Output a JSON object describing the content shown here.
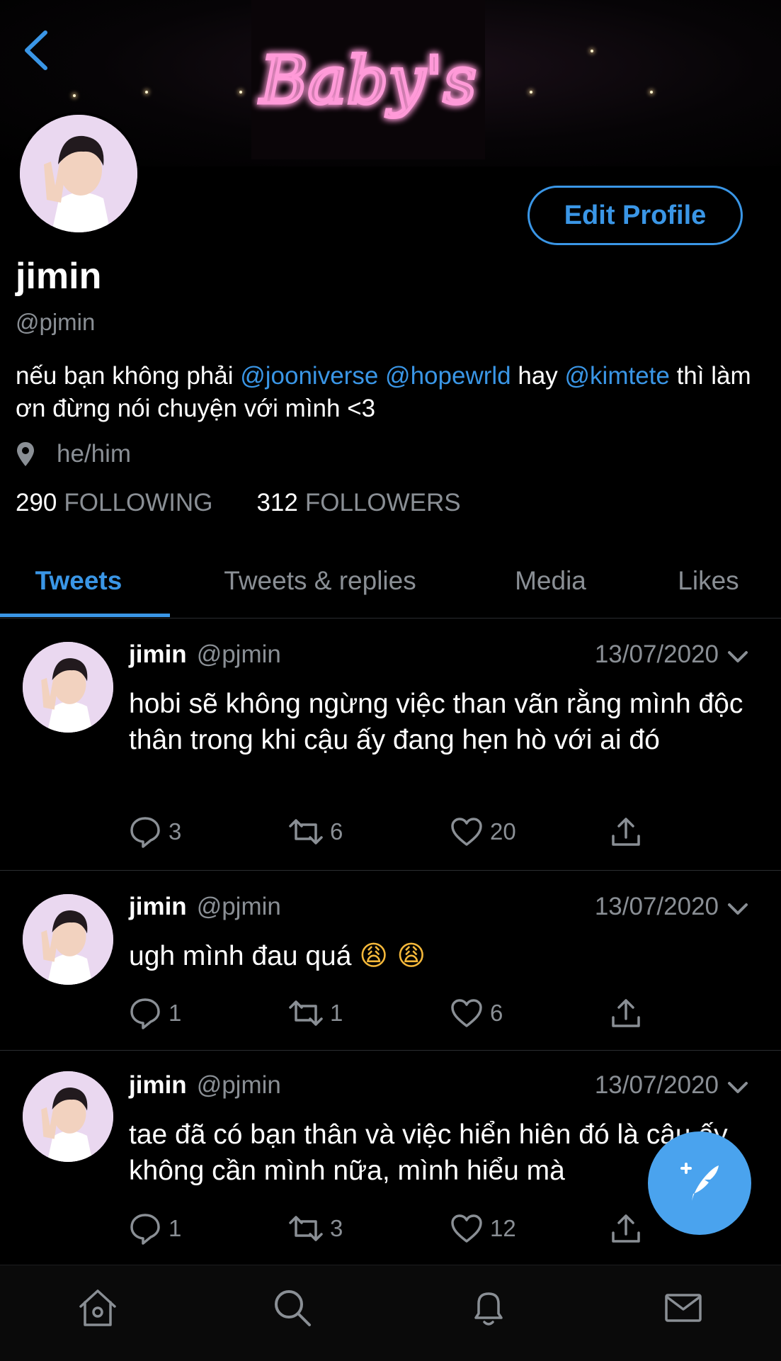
{
  "header": {
    "banner_sign_text": "Baby's",
    "back_icon": "chevron-left-icon"
  },
  "profile": {
    "edit_button_label": "Edit Profile",
    "display_name": "jimin",
    "handle": "@pjmin",
    "bio": {
      "part1": "nếu bạn không phải ",
      "mention1": "@jooniverse",
      "part2": " ",
      "mention2": "@hopewrld",
      "part3": " hay ",
      "mention3": "@kimtete",
      "part4": " thì làm ơn đừng nói chuyện với mình <3"
    },
    "location": "he/him",
    "following_count": "290",
    "following_label": "FOLLOWING",
    "followers_count": "312",
    "followers_label": "FOLLOWERS"
  },
  "tabs": [
    {
      "label": "Tweets",
      "active": true
    },
    {
      "label": "Tweets & replies",
      "active": false
    },
    {
      "label": "Media",
      "active": false
    },
    {
      "label": "Likes",
      "active": false
    }
  ],
  "tweets": [
    {
      "name": "jimin",
      "handle": "@pjmin",
      "date": "13/07/2020",
      "text": "hobi sẽ không ngừng việc than vãn rằng mình độc thân trong khi cậu ấy đang hẹn hò với ai đó",
      "replies": "3",
      "retweets": "6",
      "likes": "20"
    },
    {
      "name": "jimin",
      "handle": "@pjmin",
      "date": "13/07/2020",
      "text": "ugh mình đau quá",
      "emoji": "😩 😩",
      "replies": "1",
      "retweets": "1",
      "likes": "6"
    },
    {
      "name": "jimin",
      "handle": "@pjmin",
      "date": "13/07/2020",
      "text": "tae đã có bạn thân và việc hiển hiên đó là cậu ấy không cần mình nữa, mình hiểu mà",
      "replies": "1",
      "retweets": "3",
      "likes": "12"
    }
  ],
  "colors": {
    "accent": "#3a96e6",
    "fab": "#4aa3ee",
    "muted": "#8a8f95",
    "background": "#000000"
  },
  "icons": {
    "fab": "compose-tweet-icon",
    "nav": [
      "home-icon",
      "search-icon",
      "notifications-icon",
      "messages-icon"
    ]
  }
}
